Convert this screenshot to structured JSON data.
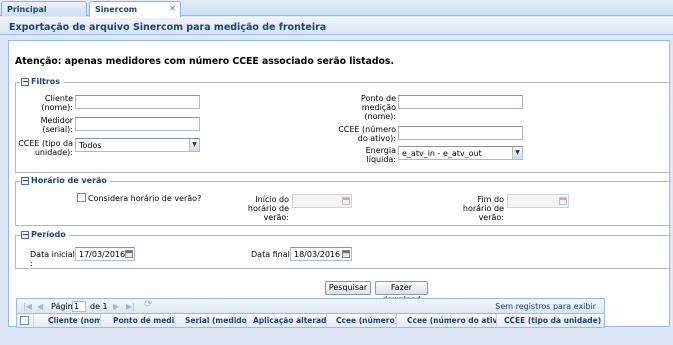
{
  "tabs": [
    {
      "label": "Principal"
    },
    {
      "label": "Sinercom"
    }
  ],
  "panel": {
    "title": "Exportação de arquivo Sinercom para medição de fronteira"
  },
  "attention": "Atenção: apenas medidores com número CCEE associado serão listados.",
  "filtros": {
    "legend": "Filtros",
    "cliente_label": "Cliente (nome):",
    "cliente_value": "",
    "medidor_label": "Medidor (serial):",
    "medidor_value": "",
    "ccee_tipo_label": "CCEE (tipo da unidade):",
    "ccee_tipo_value": "Todos",
    "ponto_label": "Ponto de medição (nome):",
    "ponto_value": "",
    "ccee_numero_label": "CCEE (número do ativo):",
    "ccee_numero_value": "",
    "energia_label": "Energia líquida:",
    "energia_value": "e_atv_in - e_atv_out"
  },
  "horario": {
    "legend": "Horário de verão",
    "checkbox_label": "Considera horário de verão?",
    "checkbox_checked": false,
    "inicio_label": "Início do horário de verão:",
    "inicio_value": "",
    "fim_label": "Fim do horário de verão:",
    "fim_value": ""
  },
  "periodo": {
    "legend": "Período",
    "data_inicial_label": "Data inicial :",
    "data_inicial_value": "17/03/2016",
    "data_final_label": "Data final :",
    "data_final_value": "18/03/2016"
  },
  "buttons": {
    "pesquisar": "Pesquisar",
    "download": "Fazer download"
  },
  "grid": {
    "page_label": "Página",
    "page_value": "1",
    "of_label": "de 1",
    "no_records": "Sem registros para exibir",
    "columns": [
      "Cliente (nome)",
      "Ponto de medição",
      "Serial (medidor)",
      "Aplicação alterado",
      "Ccee (número)",
      "Ccee (número do ativo)",
      "CCEE (tipo da unidade)"
    ]
  },
  "icons": {
    "first_page": "first-page-icon",
    "prev_page": "prev-page-icon",
    "next_page": "next-page-icon",
    "last_page": "last-page-icon",
    "refresh": "refresh-icon",
    "close_tab": "close-icon",
    "calendar": "calendar-icon",
    "dropdown": "chevron-down-icon",
    "collapse": "minus-icon"
  },
  "colors": {
    "header_text": "#15428b",
    "panel_border": "#99bbe8",
    "background": "#dfe8f6"
  }
}
